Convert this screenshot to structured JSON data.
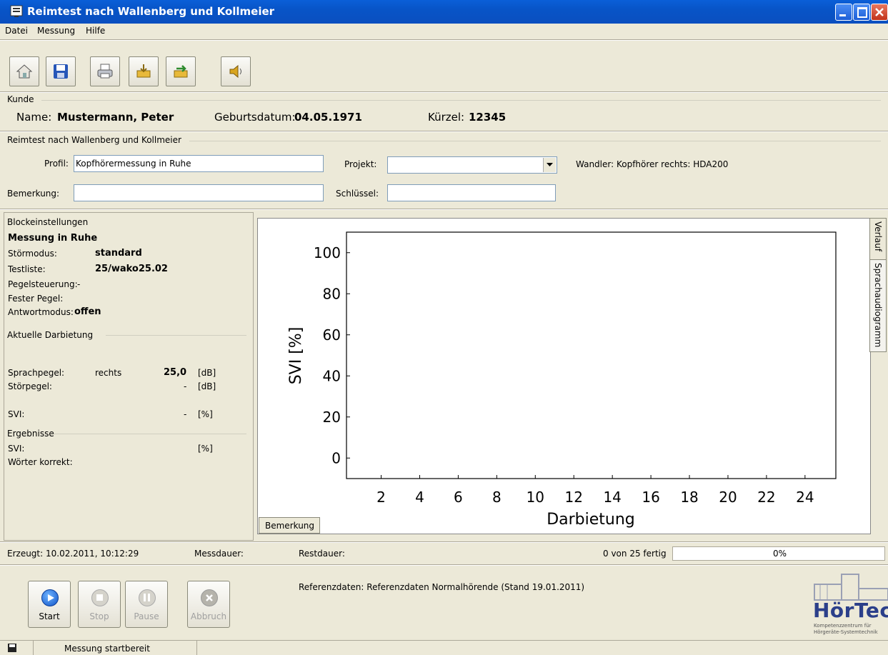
{
  "window": {
    "title": "Reimtest nach Wallenberg und Kollmeier"
  },
  "menu": [
    "Datei",
    "Messung",
    "Hilfe"
  ],
  "toolbar": {
    "icons": [
      "home-icon",
      "save-icon",
      "print-icon",
      "export-icon",
      "import-icon",
      "speaker-icon"
    ]
  },
  "kunde": {
    "legend": "Kunde",
    "name_label": "Name:",
    "name_value": "Mustermann, Peter",
    "birth_label": "Geburtsdatum:",
    "birth_value": "04.05.1971",
    "kurz_label": "Kürzel:",
    "kurz_value": "12345"
  },
  "reimtest": {
    "legend": "Reimtest nach Wallenberg und Kollmeier",
    "profil_label": "Profil:",
    "profil_value": "Kopfhörermessung in Ruhe",
    "projekt_label": "Projekt:",
    "projekt_value": "",
    "wandler_text": "Wandler: Kopfhörer  rechts: HDA200",
    "bemerkung_label": "Bemerkung:",
    "bemerkung_value": "",
    "schluessel_label": "Schlüssel:",
    "schluessel_value": ""
  },
  "block": {
    "legend": "Blockeinstellungen",
    "title": "Messung in Ruhe",
    "rows": [
      {
        "label": "Störmodus:",
        "value": "standard"
      },
      {
        "label": "Testliste:",
        "value": "25/wako25.02"
      },
      {
        "label": "Pegelsteuerung:",
        "value": "-"
      },
      {
        "label": "Fester Pegel:",
        "value": ""
      },
      {
        "label": "Antwortmodus:",
        "value": "offen"
      }
    ]
  },
  "aktuell": {
    "legend": "Aktuelle Darbietung",
    "sprach_label": "Sprachpegel:",
    "sprach_side": "rechts",
    "sprach_value": "25,0",
    "sprach_unit": "[dB]",
    "stoer_label": "Störpegel:",
    "stoer_value": "-",
    "stoer_unit": "[dB]",
    "svi_label": "SVI:",
    "svi_value": "-",
    "svi_unit": "[%]"
  },
  "ergebnisse": {
    "legend": "Ergebnisse",
    "svi_label": "SVI:",
    "svi_unit": "[%]",
    "woerter_label": "Wörter korrekt:"
  },
  "chart_data": {
    "type": "line",
    "xlabel": "Darbietung",
    "ylabel": "SVI [%]",
    "x_ticks": [
      2,
      4,
      6,
      8,
      10,
      12,
      14,
      16,
      18,
      20,
      22,
      24
    ],
    "y_ticks": [
      0,
      20,
      40,
      60,
      80,
      100
    ],
    "xlim": [
      0.2,
      25.6
    ],
    "ylim": [
      -10,
      110
    ],
    "series": [],
    "grid": false
  },
  "chart_tabs": {
    "verlauf": "Verlauf",
    "sprachaudiogramm": "Sprachaudiogramm",
    "bemerkung": "Bemerkung"
  },
  "status": {
    "erzeugt": "Erzeugt: 10.02.2011, 10:12:29",
    "messdauer": "Messdauer:",
    "restdauer": "Restdauer:",
    "fertig": "0 von 25 fertig",
    "progress_text": "0%",
    "progress": 0
  },
  "controls": {
    "start": "Start",
    "stop": "Stop",
    "pause": "Pause",
    "abbruch": "Abbruch"
  },
  "referenz": "Referenzdaten: Referenzdaten Normalhörende (Stand 19.01.2011)",
  "logo": {
    "name": "HörTech",
    "sub1": "Kompetenzzentrum für",
    "sub2": "Hörgeräte-Systemtechnik"
  },
  "statusbar": {
    "text": "Messung startbereit"
  }
}
